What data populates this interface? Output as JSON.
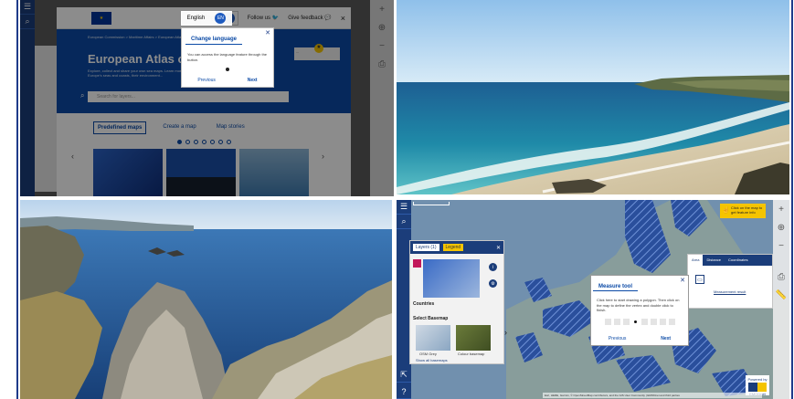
{
  "atlas": {
    "topbar": {
      "language": "English",
      "language_code": "EN",
      "follow": "Follow us",
      "feedback": "Give feedback",
      "close": "×"
    },
    "breadcrumb": "European Commission > Maritime Affairs > European Atlas...",
    "title": "European Atlas of the Seas",
    "subtitle": "Explore, collect and share your own sea maps. Learn more about Europe's seas and coasts, their environment...",
    "search_placeholder": "Search for layers...",
    "tabs": [
      "Predefined maps",
      "Create a map",
      "Map stories"
    ],
    "banner": "...",
    "tour": {
      "title": "Change language",
      "text": "You can access the language feature through the button.",
      "previous": "Previous",
      "next": "Next"
    }
  },
  "map_viewer": {
    "layers_tab": "Layers (1)",
    "legend_tab": "Legend",
    "layer_name": "Countries",
    "basemap_title": "Select Basemap",
    "basemaps": [
      "OSM Grey",
      "Colour basemap"
    ],
    "show_more": "Show all basemaps",
    "measure_tabs": [
      "Area",
      "Distance",
      "Coordinates"
    ],
    "measure_link": "Measurement result",
    "measure_popup": {
      "title": "Measure tool",
      "text": "Click here to start drawing a polygon. Then click on the map to define the vertex and double click to finish.",
      "previous": "Previous",
      "next": "Next"
    },
    "hint": "Click on the map to get feature info",
    "powered_by": "Powered by",
    "powered_org": "EMODnet",
    "attribution": "Esri, HERE, Garmin, © OpenStreetMap contributors, and the GIS User Community | EMODnet and third parties",
    "colors": {
      "navy": "#1b3d7a",
      "accent": "#f5c400",
      "hero": "#0b4aa6"
    }
  }
}
